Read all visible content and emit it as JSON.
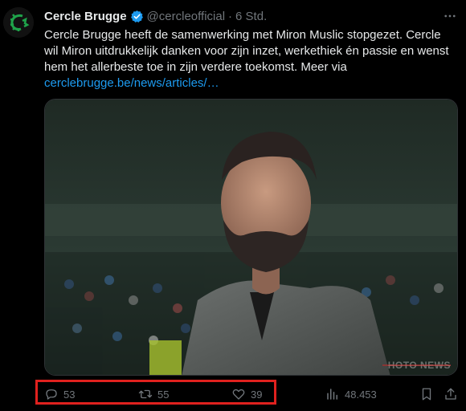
{
  "tweet": {
    "author_name": "Cercle Brugge",
    "handle": "@cercleofficial",
    "separator": "·",
    "timestamp": "6 Std.",
    "text_main": "Cercle Brugge heeft de samenwerking met Miron Muslic stopgezet. Cercle wil Miron uitdrukkelijk danken voor zijn inzet, werkethiek én passie en wenst hem het allerbeste toe in zijn verdere toekomst. Meer via ",
    "link_text": "cerclebrugge.be/news/articles/…",
    "avatar_icon": "cercle-brugge-logo-icon",
    "verified_icon": "verified-badge-icon",
    "more_icon": "more-dots-icon",
    "media_watermark": "HOTO NEWS"
  },
  "actions": {
    "reply": {
      "icon": "reply-icon",
      "count": "53"
    },
    "retweet": {
      "icon": "retweet-icon",
      "count": "55"
    },
    "like": {
      "icon": "heart-icon",
      "count": "39"
    },
    "views": {
      "icon": "views-icon",
      "count": "48.453"
    },
    "bookmark": {
      "icon": "bookmark-icon"
    },
    "share": {
      "icon": "share-icon"
    }
  },
  "colors": {
    "background": "#000000",
    "text": "#e7e9ea",
    "muted": "#71767b",
    "link": "#1d9bf0",
    "highlight": "#e0211e",
    "brand": "#1fa34a"
  }
}
